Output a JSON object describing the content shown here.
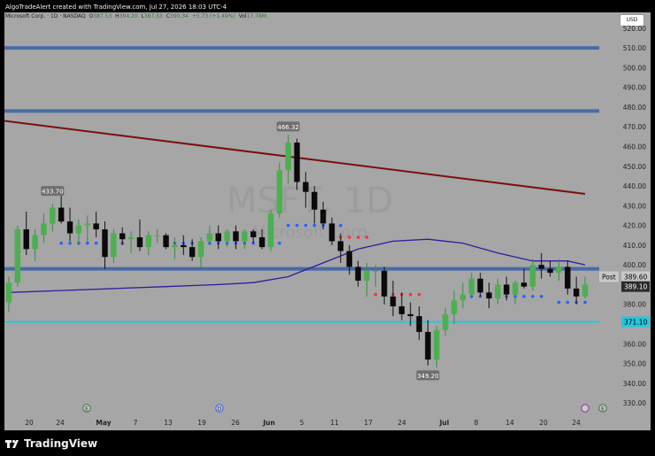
{
  "header": {
    "text": "AlgoTradeAlert created with TradingView.com, Jul 27, 2026 18:03 UTC-4"
  },
  "symbol": {
    "name": "Microsoft Corp. · 1D · NASDAQ",
    "o_label": "O",
    "o": "387.53",
    "h_label": "H",
    "h": "394.20",
    "l_label": "L",
    "l": "387.53",
    "c_label": "C",
    "c": "390.34",
    "change": "+5.73 (+1.49%)",
    "vol_label": "Vol",
    "vol": "17.78M"
  },
  "currency": "USD",
  "brand": {
    "name": "TradingView"
  },
  "watermark": {
    "ticker": "MSFT, 1D",
    "company": "Microsoft Corp"
  },
  "colors": {
    "bull": "#4caf50",
    "bear": "#0a0a0a",
    "sma_long": "#7a0f0f",
    "sma_short": "#2a1ea0",
    "level_blue": "#4a6aa8",
    "level_cyan": "#26c6da",
    "dots_blue": "#2962ff",
    "dots_red": "#f23645"
  },
  "chart_data": {
    "type": "candlestick",
    "y_axis": {
      "ticks": [
        330,
        340,
        350,
        360,
        370,
        380,
        390,
        400,
        410,
        420,
        430,
        440,
        450,
        460,
        470,
        480,
        490,
        500,
        510,
        520
      ],
      "ylim": [
        326,
        528
      ],
      "side": "right"
    },
    "x_axis": {
      "ticks": [
        "20",
        "24",
        "May",
        "7",
        "13",
        "19",
        "26",
        "Jun",
        "5",
        "11",
        "17",
        "24",
        "Jul",
        "8",
        "14",
        "20",
        "24"
      ]
    },
    "candles": [
      {
        "o": 381,
        "h": 394,
        "l": 376,
        "c": 391
      },
      {
        "o": 391,
        "h": 420,
        "l": 389,
        "c": 418
      },
      {
        "o": 418,
        "h": 427,
        "l": 405,
        "c": 408
      },
      {
        "o": 408,
        "h": 418,
        "l": 402,
        "c": 415
      },
      {
        "o": 415,
        "h": 426,
        "l": 411,
        "c": 421
      },
      {
        "o": 421,
        "h": 431,
        "l": 417,
        "c": 429
      },
      {
        "o": 429,
        "h": 436,
        "l": 421,
        "c": 422
      },
      {
        "o": 422,
        "h": 429,
        "l": 412,
        "c": 416
      },
      {
        "o": 416,
        "h": 423,
        "l": 410,
        "c": 420
      },
      {
        "o": 420,
        "h": 425,
        "l": 412,
        "c": 421
      },
      {
        "o": 421,
        "h": 427,
        "l": 414,
        "c": 418
      },
      {
        "o": 418,
        "h": 422,
        "l": 398,
        "c": 404
      },
      {
        "o": 404,
        "h": 418,
        "l": 401,
        "c": 416
      },
      {
        "o": 416,
        "h": 419,
        "l": 410,
        "c": 413
      },
      {
        "o": 413,
        "h": 417,
        "l": 406,
        "c": 414
      },
      {
        "o": 414,
        "h": 423,
        "l": 407,
        "c": 409
      },
      {
        "o": 409,
        "h": 417,
        "l": 405,
        "c": 415
      },
      {
        "o": 415,
        "h": 418,
        "l": 411,
        "c": 415
      },
      {
        "o": 415,
        "h": 416,
        "l": 408,
        "c": 409
      },
      {
        "o": 409,
        "h": 414,
        "l": 403,
        "c": 410
      },
      {
        "o": 410,
        "h": 415,
        "l": 405,
        "c": 409
      },
      {
        "o": 409,
        "h": 413,
        "l": 402,
        "c": 404
      },
      {
        "o": 404,
        "h": 414,
        "l": 398,
        "c": 412
      },
      {
        "o": 412,
        "h": 420,
        "l": 410,
        "c": 416
      },
      {
        "o": 416,
        "h": 420,
        "l": 408,
        "c": 412
      },
      {
        "o": 412,
        "h": 418,
        "l": 409,
        "c": 417
      },
      {
        "o": 417,
        "h": 420,
        "l": 408,
        "c": 412
      },
      {
        "o": 412,
        "h": 418,
        "l": 408,
        "c": 417
      },
      {
        "o": 417,
        "h": 418,
        "l": 411,
        "c": 414
      },
      {
        "o": 414,
        "h": 418,
        "l": 408,
        "c": 409
      },
      {
        "o": 409,
        "h": 428,
        "l": 407,
        "c": 426
      },
      {
        "o": 426,
        "h": 452,
        "l": 424,
        "c": 448
      },
      {
        "o": 448,
        "h": 466,
        "l": 441,
        "c": 462
      },
      {
        "o": 462,
        "h": 464,
        "l": 438,
        "c": 442
      },
      {
        "o": 442,
        "h": 447,
        "l": 429,
        "c": 437
      },
      {
        "o": 437,
        "h": 440,
        "l": 421,
        "c": 428
      },
      {
        "o": 428,
        "h": 432,
        "l": 418,
        "c": 421
      },
      {
        "o": 421,
        "h": 424,
        "l": 410,
        "c": 412
      },
      {
        "o": 412,
        "h": 416,
        "l": 401,
        "c": 407
      },
      {
        "o": 407,
        "h": 410,
        "l": 395,
        "c": 399
      },
      {
        "o": 399,
        "h": 402,
        "l": 389,
        "c": 392
      },
      {
        "o": 392,
        "h": 401,
        "l": 384,
        "c": 397
      },
      {
        "o": 397,
        "h": 400,
        "l": 389,
        "c": 397
      },
      {
        "o": 397,
        "h": 399,
        "l": 380,
        "c": 384
      },
      {
        "o": 384,
        "h": 392,
        "l": 374,
        "c": 379
      },
      {
        "o": 379,
        "h": 386,
        "l": 372,
        "c": 375
      },
      {
        "o": 375,
        "h": 381,
        "l": 369,
        "c": 374
      },
      {
        "o": 374,
        "h": 379,
        "l": 362,
        "c": 366
      },
      {
        "o": 366,
        "h": 372,
        "l": 349,
        "c": 352
      },
      {
        "o": 352,
        "h": 369,
        "l": 348,
        "c": 367
      },
      {
        "o": 367,
        "h": 378,
        "l": 364,
        "c": 375
      },
      {
        "o": 375,
        "h": 387,
        "l": 370,
        "c": 382
      },
      {
        "o": 382,
        "h": 391,
        "l": 378,
        "c": 385
      },
      {
        "o": 385,
        "h": 396,
        "l": 383,
        "c": 393
      },
      {
        "o": 393,
        "h": 396,
        "l": 384,
        "c": 386
      },
      {
        "o": 386,
        "h": 391,
        "l": 378,
        "c": 383
      },
      {
        "o": 383,
        "h": 393,
        "l": 380,
        "c": 390
      },
      {
        "o": 390,
        "h": 394,
        "l": 382,
        "c": 385
      },
      {
        "o": 385,
        "h": 392,
        "l": 380,
        "c": 391
      },
      {
        "o": 391,
        "h": 398,
        "l": 388,
        "c": 389
      },
      {
        "o": 389,
        "h": 403,
        "l": 387,
        "c": 400
      },
      {
        "o": 400,
        "h": 406,
        "l": 393,
        "c": 398
      },
      {
        "o": 398,
        "h": 402,
        "l": 394,
        "c": 396
      },
      {
        "o": 396,
        "h": 403,
        "l": 392,
        "c": 399
      },
      {
        "o": 399,
        "h": 402,
        "l": 385,
        "c": 388
      },
      {
        "o": 388,
        "h": 394,
        "l": 380,
        "c": 384
      },
      {
        "o": 384,
        "h": 394,
        "l": 383,
        "c": 390
      }
    ],
    "sma_long": {
      "start": 473,
      "end": 436
    },
    "sma_short": [
      [
        0,
        386
      ],
      [
        6,
        387
      ],
      [
        12,
        388
      ],
      [
        18,
        389
      ],
      [
        24,
        390
      ],
      [
        28,
        391
      ],
      [
        32,
        394
      ],
      [
        36,
        401
      ],
      [
        40,
        408
      ],
      [
        44,
        412
      ],
      [
        48,
        413
      ],
      [
        52,
        411
      ],
      [
        56,
        406
      ],
      [
        60,
        402
      ],
      [
        64,
        402
      ],
      [
        66,
        400
      ]
    ],
    "levels": [
      {
        "value": 510,
        "color": "blue"
      },
      {
        "value": 478,
        "color": "blue"
      },
      {
        "value": 398,
        "color": "blue"
      },
      {
        "value": 371.1,
        "color": "cyan"
      }
    ],
    "price_labels": [
      {
        "text": "389.60",
        "value": 394,
        "style": "post"
      },
      {
        "text": "389.10",
        "value": 389,
        "style": "dark"
      },
      {
        "text": "371.10",
        "value": 371.1,
        "style": "cyan"
      }
    ],
    "post_label": "Post",
    "annotations": [
      {
        "text": "433.70",
        "index": 5,
        "value": 433.7
      },
      {
        "text": "466.32",
        "index": 32,
        "value": 466.32
      },
      {
        "text": "349.20",
        "index": 48,
        "value": 349.2
      }
    ],
    "blue_dots": [
      {
        "value": 411,
        "from": 6,
        "to": 13
      },
      {
        "value": 411,
        "from": 18,
        "to": 31
      },
      {
        "value": 420,
        "from": 32,
        "to": 38
      },
      {
        "value": 384,
        "from": 52,
        "to": 61
      },
      {
        "value": 381,
        "from": 63,
        "to": 66
      }
    ],
    "red_dots": [
      {
        "value": 414,
        "from": 38,
        "to": 41
      },
      {
        "value": 385,
        "from": 42,
        "to": 47
      }
    ],
    "markers": [
      {
        "type": "E",
        "index": 12
      },
      {
        "type": "D",
        "index": 26
      },
      {
        "type": "E",
        "index": 64
      }
    ]
  }
}
